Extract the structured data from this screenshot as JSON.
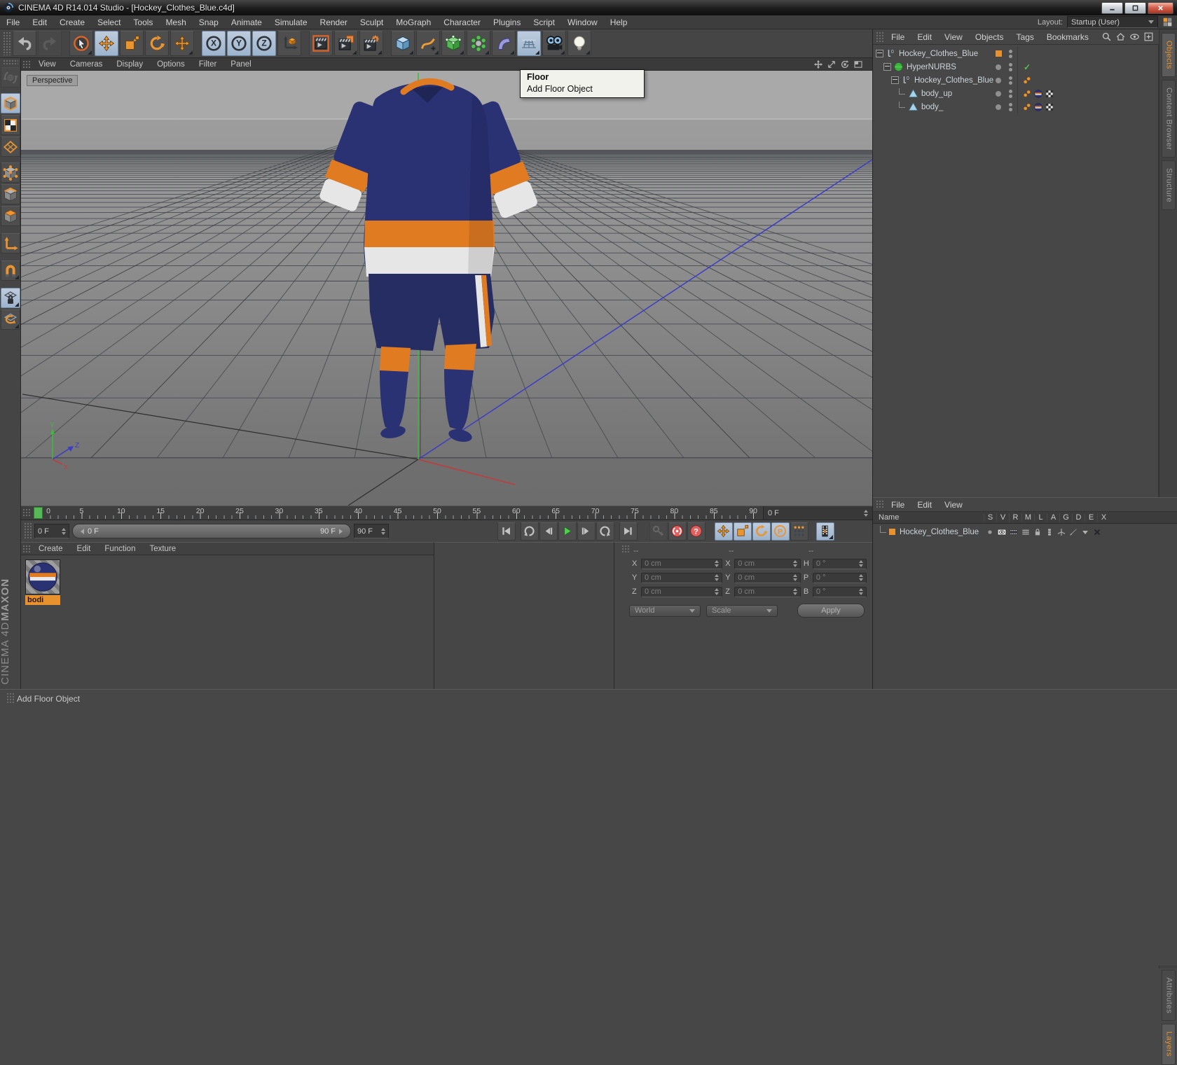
{
  "window": {
    "title": "CINEMA 4D R14.014 Studio - [Hockey_Clothes_Blue.c4d]"
  },
  "menubar": {
    "items": [
      "File",
      "Edit",
      "Create",
      "Select",
      "Tools",
      "Mesh",
      "Snap",
      "Animate",
      "Simulate",
      "Render",
      "Sculpt",
      "MoGraph",
      "Character",
      "Plugins",
      "Script",
      "Window",
      "Help"
    ],
    "layout_label": "Layout:",
    "layout_value": "Startup (User)"
  },
  "top_toolbar": {
    "buttons": [
      {
        "name": "undo",
        "icon": "undo"
      },
      {
        "name": "redo",
        "icon": "redo",
        "disabled": true
      },
      {
        "sep": true
      },
      {
        "name": "live-selection",
        "icon": "live-selection",
        "flyout": true
      },
      {
        "name": "move-tool",
        "icon": "move",
        "active": true
      },
      {
        "name": "scale-tool",
        "icon": "scale"
      },
      {
        "name": "rotate-tool",
        "icon": "rotate"
      },
      {
        "name": "last-used-tool",
        "icon": "move",
        "flyout": true
      },
      {
        "sep": true
      },
      {
        "name": "lock-x-axis",
        "icon": "axis-circle",
        "letter": "X",
        "active": true
      },
      {
        "name": "lock-y-axis",
        "icon": "axis-circle",
        "letter": "Y",
        "active": true
      },
      {
        "name": "lock-z-axis",
        "icon": "axis-circle",
        "letter": "Z",
        "active": true
      },
      {
        "name": "coordinate-system",
        "icon": "coord-system"
      },
      {
        "sep": true
      },
      {
        "name": "render-view",
        "icon": "render-view"
      },
      {
        "name": "render-to-picture-viewer",
        "icon": "render-pv",
        "flyout": true
      },
      {
        "name": "render-settings",
        "icon": "render-settings",
        "flyout": true
      },
      {
        "sep": true
      },
      {
        "name": "add-cube-primitive",
        "icon": "cube",
        "flyout": true
      },
      {
        "name": "add-spline",
        "icon": "spline",
        "flyout": true
      },
      {
        "name": "add-hypernurbs",
        "icon": "hypernurbs",
        "flyout": true
      },
      {
        "name": "add-mograph-object",
        "icon": "mograph",
        "flyout": true
      },
      {
        "name": "add-deformer",
        "icon": "deformer",
        "flyout": true
      },
      {
        "name": "add-floor-object",
        "icon": "floor",
        "hover": true,
        "flyout": true
      },
      {
        "name": "add-camera",
        "icon": "camera",
        "flyout": true
      },
      {
        "name": "add-light",
        "icon": "light",
        "flyout": true
      }
    ]
  },
  "left_toolbar": {
    "buttons": [
      {
        "name": "make-editable",
        "icon": "make-editable",
        "disabled": true
      },
      {
        "gap": 6
      },
      {
        "name": "model-mode",
        "icon": "model-mode",
        "active": true
      },
      {
        "name": "texture-mode",
        "icon": "texture-mode"
      },
      {
        "name": "workplane-mode",
        "icon": "workplane"
      },
      {
        "gap": 6
      },
      {
        "name": "points-mode",
        "icon": "points-mode"
      },
      {
        "name": "edges-mode",
        "icon": "edges-mode"
      },
      {
        "name": "polygons-mode",
        "icon": "polygons-mode"
      },
      {
        "gap": 8
      },
      {
        "name": "enable-axis-modification",
        "icon": "axis-tool"
      },
      {
        "gap": 8
      },
      {
        "name": "snap-settings",
        "icon": "snap",
        "flyout": true
      },
      {
        "gap": 8
      },
      {
        "name": "lock-workplane",
        "icon": "lock-workplane",
        "active": true,
        "flyout": true
      },
      {
        "name": "workplane-modes",
        "icon": "workplane-rotate",
        "flyout": true
      }
    ]
  },
  "viewport": {
    "menu": [
      "View",
      "Cameras",
      "Display",
      "Options",
      "Filter",
      "Panel"
    ],
    "label": "Perspective",
    "controls": [
      {
        "name": "viewport-pan",
        "icon": "vp-pan"
      },
      {
        "name": "viewport-zoom",
        "icon": "vp-zoom"
      },
      {
        "name": "viewport-rotate",
        "icon": "vp-rotate"
      },
      {
        "name": "viewport-toggle",
        "icon": "vp-toggle"
      }
    ],
    "gizmo": {
      "x": "X",
      "y": "Y",
      "z": "Z"
    }
  },
  "tooltip": {
    "title": "Floor",
    "line2": "Add Floor Object"
  },
  "timeline": {
    "frame_labels": [
      0,
      5,
      10,
      15,
      20,
      25,
      30,
      35,
      40,
      45,
      50,
      55,
      60,
      65,
      70,
      75,
      80,
      85,
      90
    ],
    "current_frame": "0 F"
  },
  "playback": {
    "start": "0 F",
    "range_start": "0 F",
    "range_end": "90 F",
    "end": "90 F",
    "buttons": [
      {
        "name": "goto-start",
        "icon": "skip-start"
      },
      {
        "gap": 6
      },
      {
        "name": "play-backwards",
        "icon": "arc-ccw"
      },
      {
        "name": "previous-frame",
        "icon": "prev-frame"
      },
      {
        "name": "play-forwards",
        "icon": "play"
      },
      {
        "name": "next-frame",
        "icon": "next-frame"
      },
      {
        "name": "play-cycle",
        "icon": "arc-cw"
      },
      {
        "gap": 6
      },
      {
        "name": "goto-end",
        "icon": "skip-end"
      },
      {
        "gap": 16
      },
      {
        "name": "record-active-objects",
        "icon": "key",
        "disabled": true
      },
      {
        "name": "autokeying",
        "icon": "autokey"
      },
      {
        "name": "keyframe-selection",
        "icon": "question"
      },
      {
        "gap": 12
      },
      {
        "name": "key-position",
        "icon": "move",
        "active": true
      },
      {
        "name": "key-scale",
        "icon": "scale",
        "active": true
      },
      {
        "name": "key-rotation",
        "icon": "rotate",
        "active": true
      },
      {
        "name": "key-parameter",
        "icon": "circle-p",
        "active": true
      },
      {
        "name": "key-point-level",
        "icon": "dots-grid"
      },
      {
        "gap": 10
      },
      {
        "name": "timeline-window",
        "icon": "filmstrip",
        "active": true,
        "flyout": true
      }
    ]
  },
  "material_manager": {
    "menu": [
      "Create",
      "Edit",
      "Function",
      "Texture"
    ],
    "materials": [
      {
        "name": "bodi",
        "selected": true
      }
    ]
  },
  "coordinates": {
    "headers": [
      "--",
      "--",
      "--"
    ],
    "rows": [
      {
        "cells": [
          {
            "label": "X",
            "value": "0 cm"
          },
          {
            "label": "X",
            "value": "0 cm"
          },
          {
            "label": "H",
            "value": "0 °"
          }
        ]
      },
      {
        "cells": [
          {
            "label": "Y",
            "value": "0 cm"
          },
          {
            "label": "Y",
            "value": "0 cm"
          },
          {
            "label": "P",
            "value": "0 °"
          }
        ]
      },
      {
        "cells": [
          {
            "label": "Z",
            "value": "0 cm"
          },
          {
            "label": "Z",
            "value": "0 cm"
          },
          {
            "label": "B",
            "value": "0 °"
          }
        ]
      }
    ],
    "combo1": "World",
    "combo2": "Scale",
    "apply_label": "Apply"
  },
  "object_manager": {
    "menu": [
      "File",
      "Edit",
      "View",
      "Objects",
      "Tags",
      "Bookmarks"
    ],
    "toolbar_icons": [
      {
        "name": "search",
        "icon": "search"
      },
      {
        "name": "home",
        "icon": "home"
      },
      {
        "name": "filter-eye",
        "icon": "eye"
      },
      {
        "name": "add-panel",
        "icon": "addpanel"
      }
    ],
    "tabs": [
      {
        "label": "Objects",
        "active": true
      },
      {
        "label": "Content Browser"
      },
      {
        "label": "Structure"
      }
    ],
    "tree": [
      {
        "label": "Hockey_Clothes_Blue",
        "indent": 0,
        "icon": "null-object",
        "expander": true,
        "layer": "square",
        "tags": []
      },
      {
        "label": "HyperNURBS",
        "indent": 1,
        "icon": "hypernurbs-obj",
        "expander": true,
        "layer": "dot",
        "check": true,
        "tags": []
      },
      {
        "label": "Hockey_Clothes_Blue",
        "indent": 2,
        "icon": "null-object",
        "expander": true,
        "layer": "dot",
        "tags": [
          "phong-tag"
        ]
      },
      {
        "label": "body_up",
        "indent": 3,
        "icon": "polygon-object",
        "layer": "dot",
        "tags": [
          "phong-tag",
          "material-tag",
          "uvw-tag"
        ]
      },
      {
        "label": "body_",
        "indent": 3,
        "icon": "polygon-object",
        "layer": "dot",
        "tags": [
          "phong-tag",
          "material-tag",
          "uvw-tag"
        ]
      }
    ]
  },
  "layer_manager": {
    "menu": [
      "File",
      "Edit",
      "View"
    ],
    "name_header": "Name",
    "columns": [
      "S",
      "V",
      "R",
      "M",
      "L",
      "A",
      "G",
      "D",
      "E",
      "X"
    ],
    "rows": [
      {
        "name": "Hockey_Clothes_Blue",
        "cell_icons": [
          "cell-dot",
          "cell-eye",
          "cell-film",
          "cell-bars",
          "cell-lock",
          "cell-stack",
          "cell-axes",
          "cell-brush",
          "cell-tri",
          "cell-x"
        ]
      }
    ],
    "tabs": [
      {
        "label": "Attributes"
      },
      {
        "label": "Layers",
        "active": true
      }
    ]
  },
  "status_bar": {
    "text": "Add Floor Object"
  },
  "branding": {
    "brand": "MAXON",
    "product": "CINEMA 4D"
  },
  "colors": {
    "accent_orange": "#e9912c",
    "selection_blue": "#9db4cd",
    "jersey_navy": "#2b3273",
    "shorts_navy": "#262d63",
    "jersey_orange": "#e07b22",
    "jersey_white": "#e6e6e6",
    "play_green": "#4ed04e",
    "axis_x": "#c23b3b",
    "axis_y": "#3dba3d",
    "axis_z": "#3c3cc8"
  }
}
